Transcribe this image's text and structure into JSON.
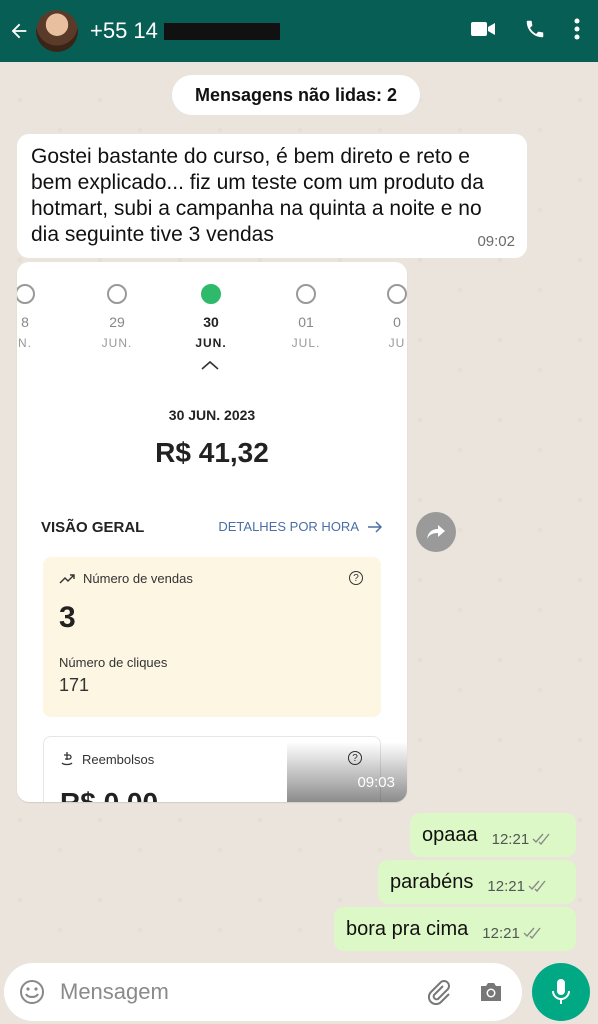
{
  "header": {
    "phone_number": "+55 14",
    "icons": [
      "back-arrow-icon",
      "video-call-icon",
      "phone-icon",
      "menu-icon"
    ]
  },
  "chat": {
    "unread_banner": "Mensagens não lidas: 2",
    "incoming": {
      "text": "Gostei bastante do curso, é bem direto e reto e bem explicado... fiz um teste com um produto da hotmart, subi a campanha na quinta a noite e no dia seguinte tive 3 vendas",
      "time": "09:02"
    },
    "image_message": {
      "time": "09:03",
      "calendar": [
        {
          "num": "8",
          "mon": "N."
        },
        {
          "num": "29",
          "mon": "JUN."
        },
        {
          "num": "30",
          "mon": "JUN."
        },
        {
          "num": "01",
          "mon": "JUL."
        },
        {
          "num": "0",
          "mon": "JU"
        }
      ],
      "selected_date": "30 JUN. 2023",
      "amount": "R$ 41,32",
      "overview_label": "VISÃO GERAL",
      "details_link": "DETALHES POR HORA",
      "sales_label": "Número de vendas",
      "sales_value": "3",
      "clicks_label": "Número de cliques",
      "clicks_value": "171",
      "refunds_label": "Reembolsos",
      "refunds_value_partial": "R$ 0,00"
    },
    "outgoing": [
      {
        "text": "opaaa",
        "time": "12:21"
      },
      {
        "text": "parabéns",
        "time": "12:21"
      },
      {
        "text": "bora pra cima",
        "time": "12:21"
      }
    ]
  },
  "input": {
    "placeholder": "Mensagem"
  },
  "colors": {
    "header": "#075e54",
    "outgoing": "#dcf8c6",
    "mic": "#00a884",
    "selected_day": "#2eba6a"
  }
}
